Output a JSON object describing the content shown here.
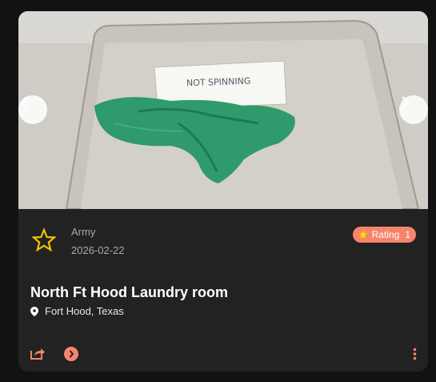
{
  "post": {
    "photo_alt": "Green cloth on washer lid",
    "photo_note_text": "NOT SPINNING",
    "branch": "Army",
    "date": "2026-02-22",
    "rating_label": "Rating",
    "rating_value": "1",
    "title": "North Ft Hood Laundry room",
    "location": "Fort Hood, Texas"
  },
  "colors": {
    "accent": "#f6846b",
    "badge_star": "#f2c200",
    "card_bg": "#222222",
    "page_bg": "#121212"
  },
  "icons": {
    "prev": "chevron-left-icon",
    "next": "chevron-right-icon",
    "badge": "star-outline-icon",
    "rating": "star-icon",
    "location": "map-pin-icon",
    "share": "share-icon",
    "go": "arrow-circle-right-icon",
    "more": "more-vertical-icon"
  }
}
